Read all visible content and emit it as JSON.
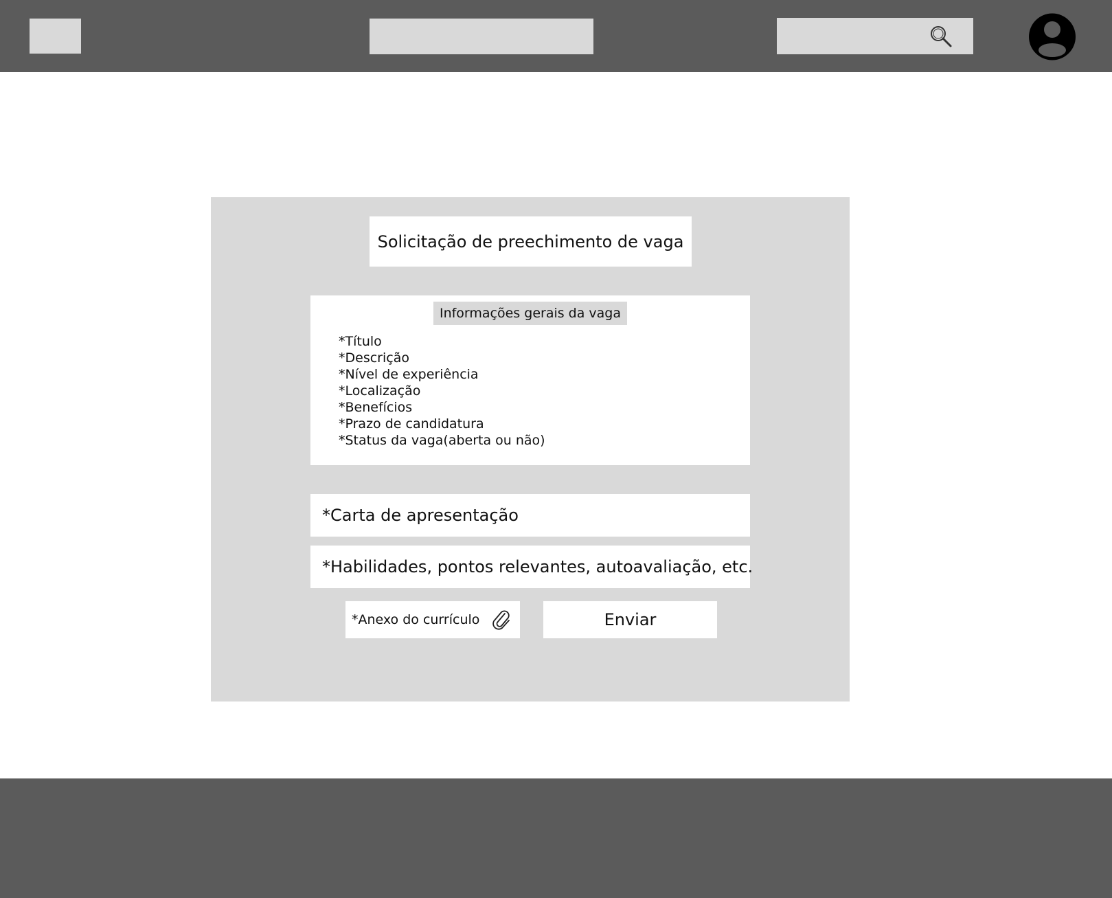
{
  "header": {
    "icons": {
      "search": "search-icon",
      "avatar": "user-avatar-icon"
    },
    "colors": {
      "bar": "#5b5b5b",
      "placeholder": "#d9d9d9"
    }
  },
  "form": {
    "title": "Solicitação de preechimento de vaga",
    "info_section": {
      "heading": "Informações gerais da vaga",
      "items": [
        "*Título",
        "*Descrição",
        "*Nível de experiência",
        "*Localização",
        "*Benefícios",
        "*Prazo de candidatura",
        "*Status da vaga(aberta ou não)"
      ]
    },
    "cover_letter_placeholder": "*Carta de apresentação",
    "skills_placeholder": "*Habilidades, pontos relevantes, autoavaliação, etc.",
    "attachment_label": "*Anexo do currículo",
    "attachment_icon": "paperclip-icon",
    "submit_label": "Enviar"
  }
}
